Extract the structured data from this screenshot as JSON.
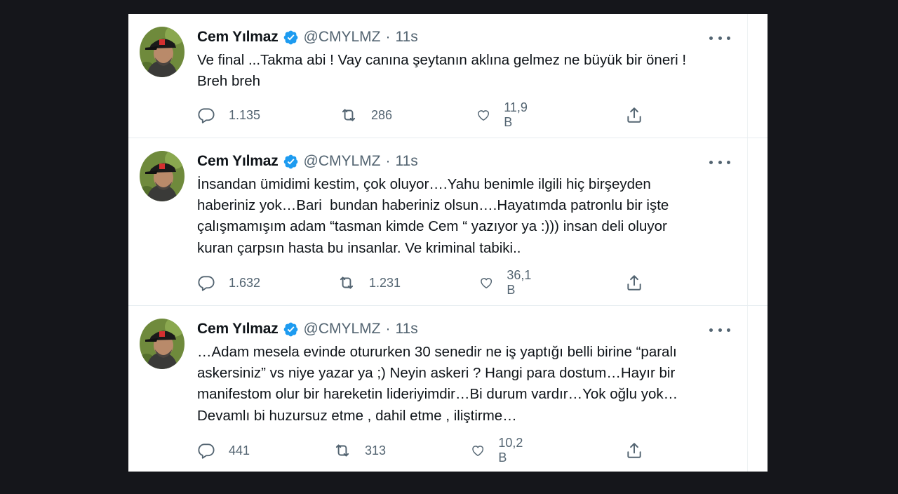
{
  "tweets": [
    {
      "name": "Cem Yılmaz",
      "handle": "@CMYLMZ",
      "separator": "·",
      "time": "11s",
      "text": "Ve final ...Takma abi ! Vay canına şeytanın aklına gelmez ne büyük bir öneri !\nBreh breh",
      "replies": "1.135",
      "retweets": "286",
      "likes": "11,9 B"
    },
    {
      "name": "Cem Yılmaz",
      "handle": "@CMYLMZ",
      "separator": "·",
      "time": "11s",
      "text": "İnsandan ümidimi kestim, çok oluyor….Yahu benimle ilgili hiç birşeyden\nhaberiniz yok…Bari  bundan haberiniz olsun….Hayatımda patronlu bir işte\nçalışmamışım adam “tasman kimde Cem “ yazıyor ya :))) insan deli oluyor\nkuran çarpsın hasta bu insanlar. Ve kriminal tabiki..",
      "replies": "1.632",
      "retweets": "1.231",
      "likes": "36,1 B"
    },
    {
      "name": "Cem Yılmaz",
      "handle": "@CMYLMZ",
      "separator": "·",
      "time": "11s",
      "text": "…Adam mesela evinde otururken 30 senedir ne iş yaptığı belli birine “paralı\naskersiniz” vs niye yazar ya ;) Neyin askeri ? Hangi para dostum…Hayır bir\nmanifestom olur bir hareketin lideriyimdir…Bi durum vardır…Yok oğlu yok…\nDevamlı bi huzursuz etme , dahil etme , iliştirme…",
      "replies": "441",
      "retweets": "313",
      "likes": "10,2 B"
    }
  ],
  "icons": {
    "verified": "verified-badge-icon",
    "reply": "reply-icon",
    "retweet": "retweet-icon",
    "like": "heart-icon",
    "share": "share-icon",
    "more": "more-icon"
  },
  "colors": {
    "verified": "#1d9bf0",
    "text": "#0f1419",
    "secondary": "#536471",
    "backdrop": "#15161b"
  }
}
